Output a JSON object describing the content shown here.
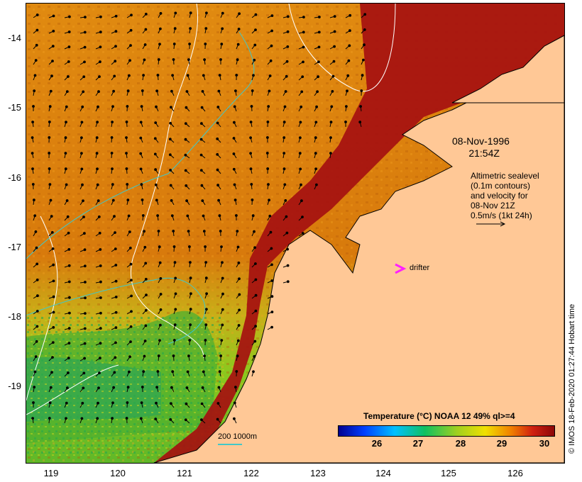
{
  "map": {
    "y_axis_labels": [
      "-14",
      "-15",
      "-16",
      "-17",
      "-18",
      "-19"
    ],
    "x_axis_labels": [
      "119",
      "120",
      "121",
      "122",
      "123",
      "124",
      "125",
      "126"
    ],
    "date": "08-Nov-1996",
    "time": "21:54Z",
    "legend_lines": [
      "Altimetric sealevel",
      "(0.1m contours)",
      "and velocity for",
      "08-Nov 21Z",
      "0.5m/s (1kt 24h)"
    ],
    "drifter_label": "drifter",
    "depth_label": "200  1000m",
    "colorbar_title": "Temperature (°C) NOAA 12 49% ql>=4",
    "colorbar_ticks": [
      "26",
      "27",
      "28",
      "29",
      "30"
    ],
    "credit": "© IMOS 18-Feb-2020 01:27:44 Hobart time",
    "colors": {
      "land": "#ffc896",
      "warm_water": "#e07a0a",
      "hot_water": "#a50f0f",
      "cool_water": "#7cc21a",
      "contour": "#ffffff",
      "isobath": "#40c8c8",
      "drifter": "#ff20ff"
    }
  }
}
